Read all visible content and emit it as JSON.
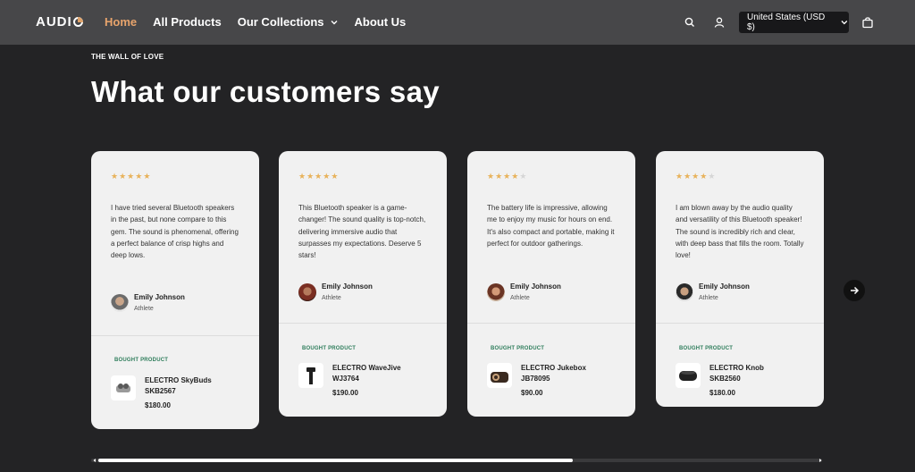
{
  "header": {
    "logo": "AUDI",
    "nav": [
      {
        "label": "Home"
      },
      {
        "label": "All Products"
      },
      {
        "label": "Our Collections"
      },
      {
        "label": "About Us"
      }
    ],
    "currency": "United States (USD $)"
  },
  "section": {
    "eyebrow": "THE WALL OF LOVE",
    "title": "What our customers say"
  },
  "colors": {
    "accent": "#e8a46c",
    "star": "#e8b25a",
    "bought": "#2e7d5b"
  },
  "cards": [
    {
      "rating": 5,
      "quote": "I have tried several Bluetooth speakers in the past, but none compare to this gem. The sound is phenomenal, offering a perfect balance of crisp highs and deep lows.",
      "author": "Emily Johnson",
      "role": "Athlete",
      "bought_label": "BOUGHT PRODUCT",
      "product": "ELECTRO SkyBuds SKB2567",
      "price": "$180.00",
      "product_icon": "earbuds-icon"
    },
    {
      "rating": 5,
      "quote": "This Bluetooth speaker is a game-changer! The sound quality is top-notch, delivering immersive audio that surpasses my expectations. Deserve 5 stars!",
      "author": "Emily Johnson",
      "role": "Athlete",
      "bought_label": "BOUGHT PRODUCT",
      "product": "ELECTRO WaveJive WJ3764",
      "price": "$190.00",
      "product_icon": "tower-speaker-icon"
    },
    {
      "rating": 4,
      "quote": "The battery life is impressive, allowing me to enjoy my music for hours on end. It's also compact and portable, making it perfect for outdoor gatherings.",
      "author": "Emily Johnson",
      "role": "Athlete",
      "bought_label": "BOUGHT PRODUCT",
      "product": "ELECTRO Jukebox JB78095",
      "price": "$90.00",
      "product_icon": "jukebox-icon"
    },
    {
      "rating": 4,
      "quote": "I am blown away by the audio quality and versatility of this Bluetooth speaker! The sound is incredibly rich and clear, with deep bass that fills the room. Totally love!",
      "author": "Emily Johnson",
      "role": "Athlete",
      "bought_label": "BOUGHT PRODUCT",
      "product": "ELECTRO Knob SKB2560",
      "price": "$180.00",
      "product_icon": "knob-speaker-icon"
    }
  ]
}
